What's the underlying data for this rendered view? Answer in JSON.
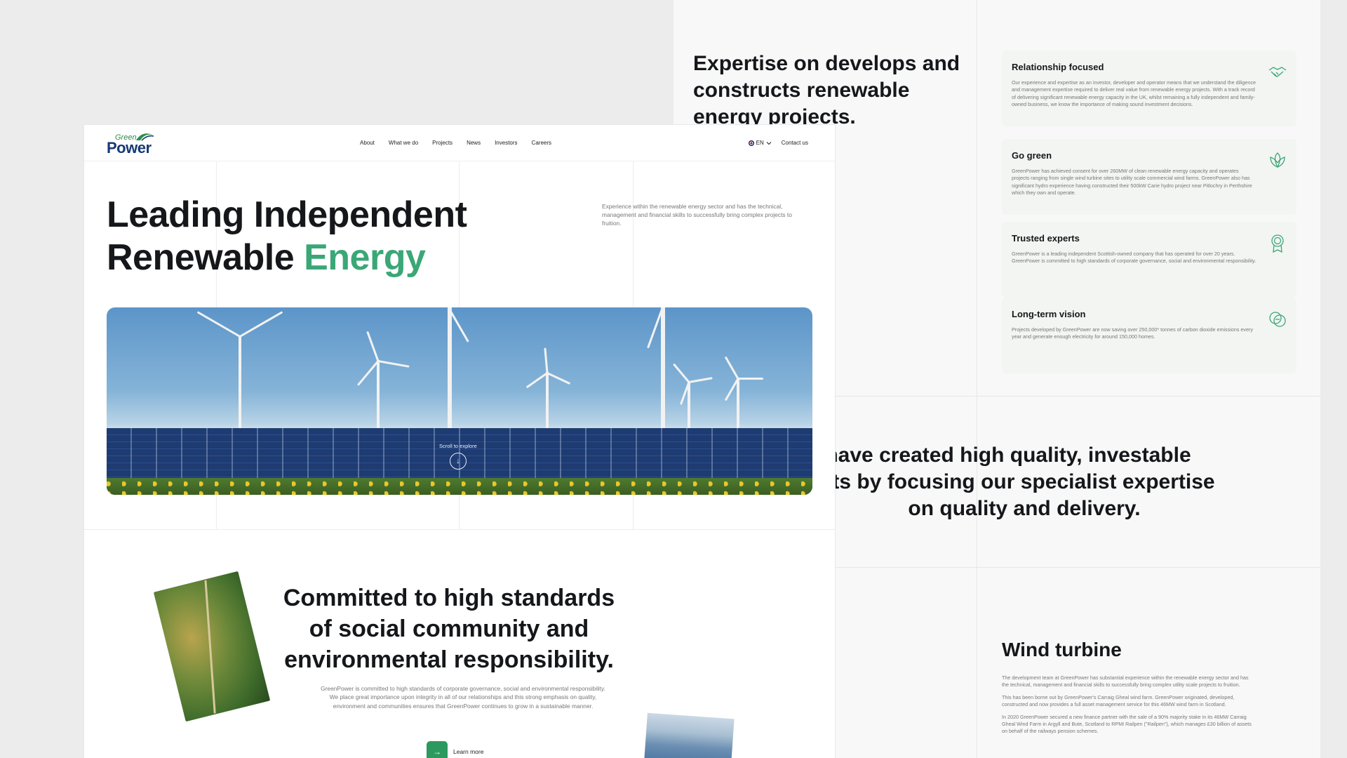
{
  "back_page": {
    "heading": "Expertise on develops and constructs renewable energy projects.",
    "features": [
      {
        "title": "Relationship focused",
        "text": "Our experience and expertise as an investor, developer and operator  means that we understand the diligence and management expertise required to deliver real value from renewable energy projects. With a track  record of delivering significant renewable energy capacity in the UK, whilst remaining a fully independent and family-owned business, we know  the importance of making sound investment decisions.",
        "icon": "handshake-icon"
      },
      {
        "title": "Go green",
        "text": "GreenPower has achieved consent for over 260MW of clean renewable energy capacity and operates projects ranging from single wind turbine sites  to utility scale commercial wind farms. GreenPower also has significant  hydro experience having constructed their 500kW Carie hydro project near Pitlochry in Perthshire which they own and operate.",
        "icon": "leaf-icon"
      },
      {
        "title": "Trusted experts",
        "text": "GreenPower is a leading independent Scottish-owned company that has operated for over 20 years. GreenPower is committed to high standards of corporate governance, social and environmental responsibility.",
        "icon": "award-icon"
      },
      {
        "title": "Long-term vision",
        "text": "Projects developed by GreenPower are now saving over 250,000* tonnes of  carbon dioxide emissions every year and generate enough electricity for  around 150,000 homes.",
        "icon": "circles-icon"
      }
    ],
    "quote_lines": [
      "have created high quality, investable",
      "ts by focusing our specialist expertise",
      "on quality and delivery."
    ],
    "wind_title": "Wind turbine",
    "wind_paragraphs": [
      "The development team at GreenPower has substantial experience within the renewable energy sector and has the technical, management and financial skills to successfully bring complex utility scale projects to fruition.",
      "This has been borne out by GreenPower's Carraig Gheal wind farm. GreenPower originated, developed, constructed and now provides a full  asset management service for this 46MW wind farm in Scotland.",
      "In 2020 GreenPower secured a new finance partner with the sale of a  90% majority stake in its 46MW Carraig Gheal Wind Farm in Argyll and  Bute, Scotland to RPMI Railpen (\"Railpen\"), which manages £30 billion of assets on behalf of the railways pension schemes."
    ]
  },
  "front_page": {
    "logo_top": "Green",
    "logo_bottom": "Power",
    "nav": [
      "About",
      "What we do",
      "Projects",
      "News",
      "Investors",
      "Careers"
    ],
    "lang": "EN",
    "contact": "Contact us",
    "hero_line1": "Leading Independent",
    "hero_line2": "Renewable ",
    "hero_accent": "Energy",
    "hero_desc": "Experience within the renewable energy sector and has the technical, management and financial skills to successfully bring complex projects to fruition.",
    "scroll_label": "Scroll to explore",
    "commit_title": "Committed to high standards of social community and environmental responsibility.",
    "commit_desc": "GreenPower is committed to high standards of corporate governance, social and environmental responsibility. We place great importance upon  integrity in all of our relationships and this strong emphasis on quality, environment and communities ensures that GreenPower continues to grow in a sustainable manner.",
    "learn_more": "Learn more"
  },
  "colors": {
    "accent": "#3ba776",
    "button": "#2c9a5e",
    "logo_blue": "#173a73"
  }
}
